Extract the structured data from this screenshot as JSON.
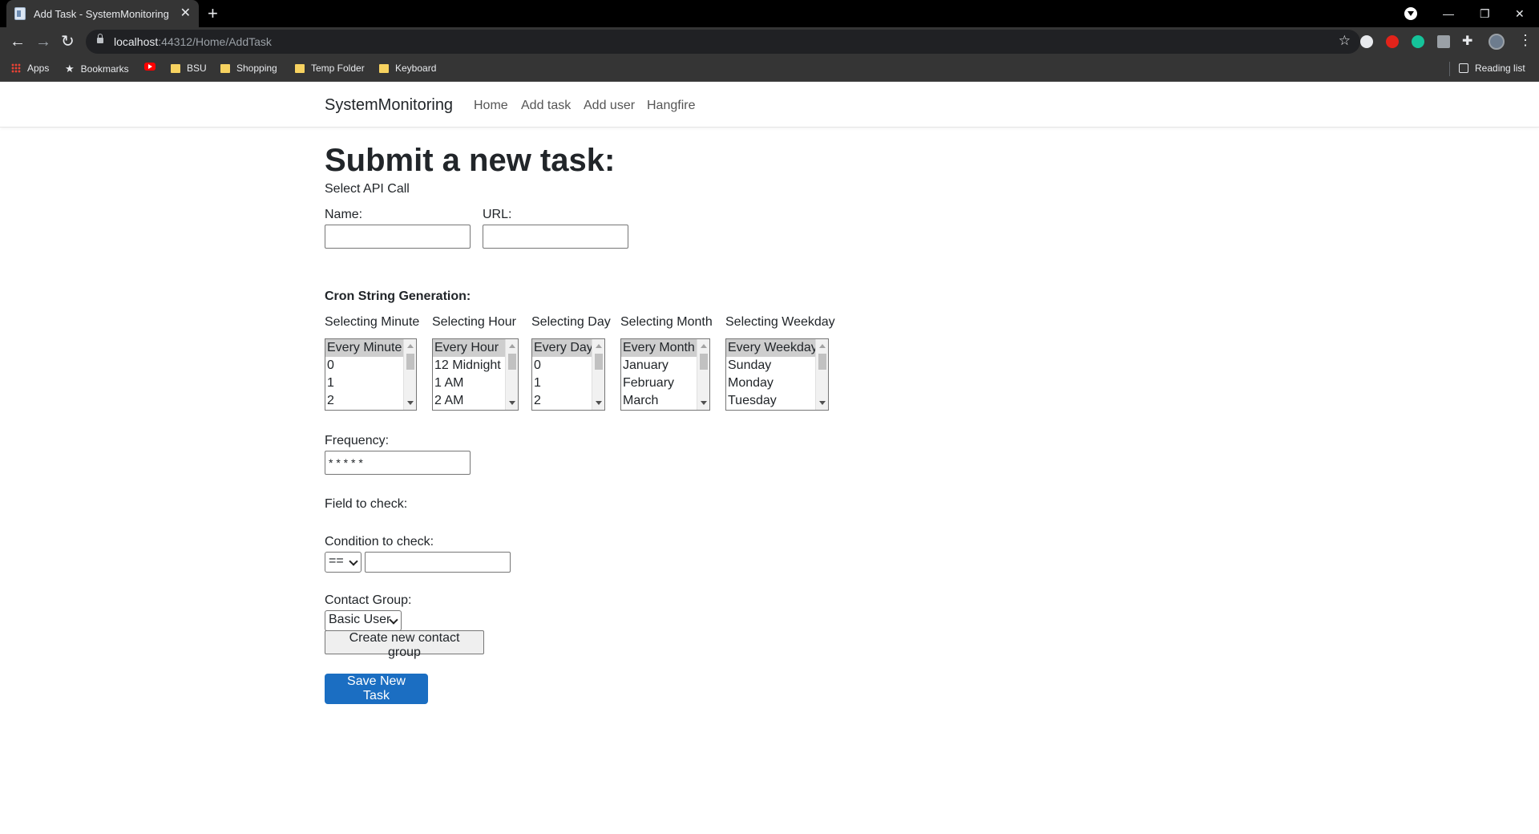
{
  "browser": {
    "tab_title": "Add Task - SystemMonitoring",
    "url_host": "localhost",
    "url_rest": ":44312/Home/AddTask",
    "bookmarks": [
      "Apps",
      "Bookmarks",
      "BSU",
      "Shopping",
      "Temp Folder",
      "Keyboard"
    ],
    "reading_list": "Reading list"
  },
  "navbar": {
    "brand": "SystemMonitoring",
    "links": [
      "Home",
      "Add task",
      "Add user",
      "Hangfire"
    ]
  },
  "form": {
    "heading": "Submit a new task:",
    "subheading": "Select API Call",
    "name_label": "Name:",
    "name_value": "",
    "url_label": "URL:",
    "url_value": "",
    "cron_heading": "Cron String Generation:",
    "selectors": [
      {
        "label": "Selecting Minute",
        "options": [
          "Every Minute",
          "0",
          "1",
          "2"
        ]
      },
      {
        "label": "Selecting Hour",
        "options": [
          "Every Hour",
          "12 Midnight",
          "1 AM",
          "2 AM"
        ]
      },
      {
        "label": "Selecting Day",
        "options": [
          "Every Day",
          "0",
          "1",
          "2"
        ]
      },
      {
        "label": "Selecting Month",
        "options": [
          "Every Month",
          "January",
          "February",
          "March"
        ]
      },
      {
        "label": "Selecting Weekday",
        "options": [
          "Every Weekday",
          "Sunday",
          "Monday",
          "Tuesday"
        ]
      }
    ],
    "frequency_label": "Frequency:",
    "frequency_value": "* * * * *",
    "field_label": "Field to check:",
    "condition_label": "Condition to check:",
    "condition_operator": "==",
    "condition_value": "",
    "contact_label": "Contact Group:",
    "contact_value": "Basic User",
    "create_group_button": "Create new contact group",
    "save_button": "Save New Task"
  },
  "colors": {
    "primary": "#1b6ec2",
    "chrome_dark": "#353535",
    "selected_option": "#cecece"
  }
}
